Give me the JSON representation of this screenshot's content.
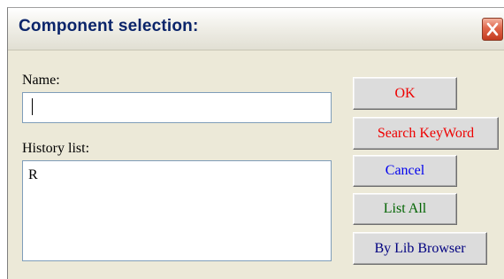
{
  "window": {
    "title": "Component selection:"
  },
  "name_field": {
    "label": "Name:",
    "value": ""
  },
  "history": {
    "label": "History list:",
    "items": [
      "R"
    ]
  },
  "buttons": {
    "ok": {
      "label": "OK",
      "color": "#ee0000"
    },
    "search_keyword": {
      "label": "Search KeyWord",
      "color": "#ee0000"
    },
    "cancel": {
      "label": "Cancel",
      "color": "#0000ee"
    },
    "list_all": {
      "label": "List All",
      "color": "#006400"
    },
    "by_lib_browser": {
      "label": "By Lib Browser",
      "color": "#000080"
    }
  },
  "icons": {
    "close": "close-icon"
  }
}
